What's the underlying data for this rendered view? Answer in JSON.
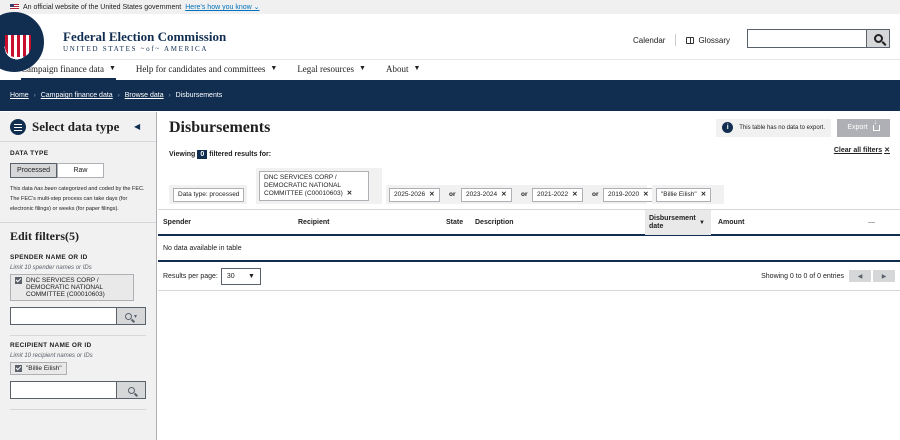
{
  "banner": {
    "text": "An official website of the United States government",
    "link": "Here’s how you know",
    "link_caret": "⌄"
  },
  "header": {
    "brand_title": "Federal Election Commission",
    "brand_sub": "UNITED STATES ~of~ AMERICA",
    "calendar": "Calendar",
    "glossary": "Glossary",
    "search_placeholder": ""
  },
  "nav": {
    "items": [
      {
        "label": "Campaign finance data"
      },
      {
        "label": "Help for candidates and committees"
      },
      {
        "label": "Legal resources"
      },
      {
        "label": "About"
      }
    ],
    "caret": "▼"
  },
  "breadcrumb": {
    "items": [
      "Home",
      "Campaign finance data",
      "Browse data"
    ],
    "current": "Disbursements",
    "sep": "›"
  },
  "sidebar": {
    "title": "Select data type",
    "collapse": "◀",
    "data_type_label": "DATA TYPE",
    "processed": "Processed",
    "raw": "Raw",
    "desc_pre": "This data ",
    "desc_em": "has been",
    "desc_post": " categorized and coded by the FEC. The FEC’s multi-step process can take days (for electronic filings) or weeks (for paper filings).",
    "edit_filters": "Edit filters",
    "filter_count": "(5)",
    "spender_label": "SPENDER NAME OR ID",
    "spender_note": "Limit 10 spender names or IDs",
    "spender_value": "DNC SERVICES CORP / DEMOCRATIC NATIONAL COMMITTEE (C00010603)",
    "recipient_label": "RECIPIENT NAME OR ID",
    "recipient_note": "Limit 10 recipient names or IDs",
    "recipient_value": "\"Billie Eilish\"",
    "dropdown_caret": "▾"
  },
  "main": {
    "title": "Disbursements",
    "no_data_notice": "This table has no data to export.",
    "export": "Export",
    "viewing": "Viewing",
    "count": "0",
    "filtered_for": "filtered results for:",
    "clear_all": "Clear all filters",
    "clear_x": "✕",
    "chips": {
      "data_type": "Data type: processed",
      "committee_line1": "DNC SERVICES CORP /",
      "committee_line2": "DEMOCRATIC NATIONAL",
      "committee_line3": "COMMITTEE (C00010603)",
      "period1": "2025-2026",
      "period2": "2023-2024",
      "period3": "2021-2022",
      "period4": "2019-2020",
      "recipient": "\"Billie Eilish\"",
      "or": "or",
      "x": "✕"
    },
    "columns": {
      "spender": "Spender",
      "recipient": "Recipient",
      "state": "State",
      "description": "Description",
      "date_line1": "Disbursement",
      "date_line2": "date",
      "amount": "Amount",
      "more": "—"
    },
    "empty": "No data available in table",
    "per_page_label": "Results per page:",
    "per_page": "30",
    "per_caret": "▼",
    "showing": "Showing 0 to 0 of 0 entries",
    "prev": "◀",
    "next": "▶",
    "sort": "▼"
  }
}
